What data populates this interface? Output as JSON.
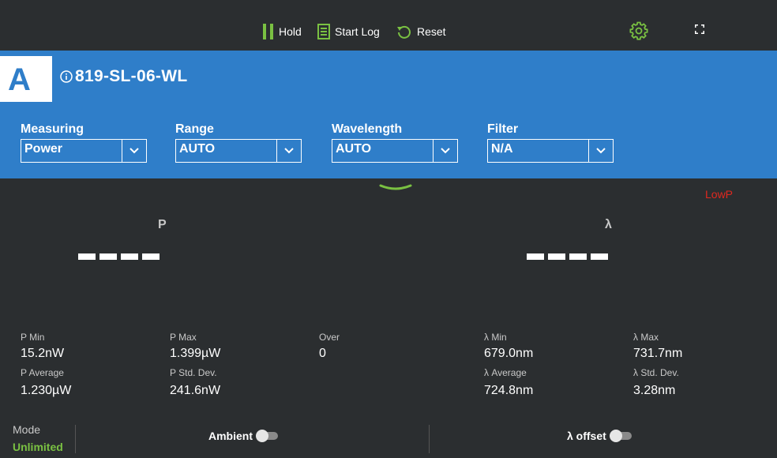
{
  "toolbar": {
    "hold_label": "Hold",
    "start_log_label": "Start Log",
    "reset_label": "Reset",
    "accent_color": "#7ac142"
  },
  "header": {
    "channel": "A",
    "device_name": "819-SL-06-WL",
    "background_color": "#2f7ec9"
  },
  "dropdowns": [
    {
      "label": "Measuring",
      "value": "Power"
    },
    {
      "label": "Range",
      "value": "AUTO"
    },
    {
      "label": "Wavelength",
      "value": "AUTO"
    },
    {
      "label": "Filter",
      "value": "N/A"
    }
  ],
  "status": {
    "warning": "LowP",
    "warning_color": "#e0281f"
  },
  "readings": {
    "power_label": "P",
    "wavelength_label": "λ"
  },
  "stats": {
    "p_min": {
      "label": "P Min",
      "value": "15.2nW"
    },
    "p_max": {
      "label": "P Max",
      "value": "1.399µW"
    },
    "over": {
      "label": "Over",
      "value": "0"
    },
    "l_min": {
      "label": "λ Min",
      "value": "679.0nm"
    },
    "l_max": {
      "label": "λ Max",
      "value": "731.7nm"
    },
    "p_avg": {
      "label": "P Average",
      "value": "1.230µW"
    },
    "p_std": {
      "label": "P Std. Dev.",
      "value": "241.6nW"
    },
    "l_avg": {
      "label": "λ Average",
      "value": "724.8nm"
    },
    "l_std": {
      "label": "λ Std. Dev.",
      "value": "3.28nm"
    }
  },
  "footer": {
    "mode_label": "Mode",
    "mode_value": "Unlimited",
    "ambient_label": "Ambient",
    "ambient_on": false,
    "offset_label": "λ offset",
    "offset_on": false
  }
}
